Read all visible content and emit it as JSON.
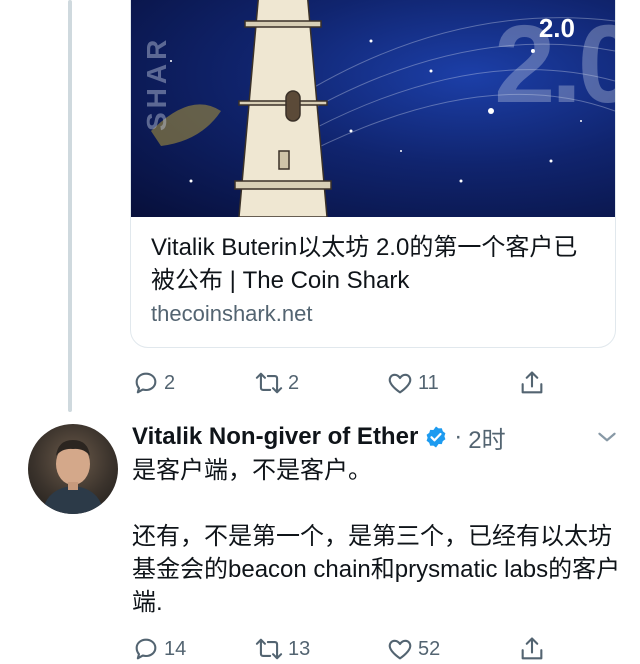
{
  "card": {
    "image_badge": "2.0",
    "image_bg_text": "2.0",
    "image_side_text": "SHAR",
    "title": "Vitalik Buterin以太坊 2.0的第一个客户已被公布 | The Coin Shark",
    "domain": "thecoinshark.net"
  },
  "actions_top": {
    "replies": "2",
    "retweets": "2",
    "likes": "11"
  },
  "tweet": {
    "author": "Vitalik Non-giver of Ether",
    "separator": "·",
    "time": "2时",
    "line1": "是客户端，不是客户。",
    "line2": "还有，不是第一个，是第三个，已经有以太坊基金会的beacon chain和prysmatic labs的客户端."
  },
  "actions_bottom": {
    "replies": "14",
    "retweets": "13",
    "likes": "52"
  },
  "colors": {
    "muted": "#536471",
    "verified": "#1d9bf0",
    "line": "#cfd9de"
  }
}
